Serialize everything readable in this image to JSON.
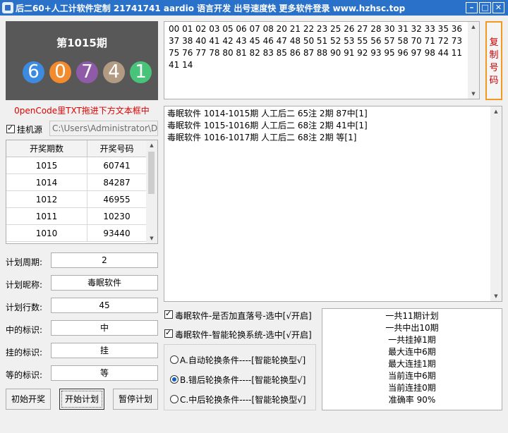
{
  "window": {
    "title": "后二60+人工计软件定制 21741741 aardio 语言开发 出号速度快 更多软件登录 www.hzhsc.top",
    "minimize": "–",
    "maximize": "□",
    "close": "✕"
  },
  "issue": {
    "title": "第1015期",
    "balls": [
      {
        "digit": "6",
        "color": "#3d8be0"
      },
      {
        "digit": "0",
        "color": "#f28a2e"
      },
      {
        "digit": "7",
        "color": "#8f5aa8"
      },
      {
        "digit": "4",
        "color": "#b39a83"
      },
      {
        "digit": "1",
        "color": "#48c37a"
      }
    ]
  },
  "numbers_text": "00 01 02 03 05 06 07 08 20 21 22 23 25 26 27 28 30 31 32 33 35 36 37 38 40 41 42 43 45 46 47 48 50 51 52 53 55 56 57 58 70 71 72 73 75 76 77 78 80 81 82 83 85 86 87 88 90 91 92 93 95 96 97 98 44 11 41 14",
  "copy_button": "复制号码",
  "hint": "0penCode里TXT拖进下方文本框中",
  "hook": {
    "label": "挂机源",
    "path": "C:\\Users\\Administrator\\Desktop"
  },
  "table": {
    "headers": [
      "开奖期数",
      "开奖号码"
    ],
    "rows": [
      [
        "1015",
        "60741"
      ],
      [
        "1014",
        "84287"
      ],
      [
        "1012",
        "46955"
      ],
      [
        "1011",
        "10230"
      ],
      [
        "1010",
        "93440"
      ]
    ]
  },
  "form": {
    "period_label": "计划周期:",
    "period_value": "2",
    "name_label": "计划昵称:",
    "name_value": "毒眠软件",
    "rows_label": "计划行数:",
    "rows_value": "45",
    "hit_label": "中的标识:",
    "hit_value": "中",
    "miss_label": "挂的标识:",
    "miss_value": "挂",
    "wait_label": "等的标识:",
    "wait_value": "等"
  },
  "buttons": {
    "init": "初始开奖",
    "start": "开始计划",
    "pause": "暂停计划"
  },
  "results": [
    "毒眠软件 1014-1015期 人工后二 65注 2期 87中[1]",
    "毒眠软件 1015-1016期 人工后二 68注 2期 41中[1]",
    "毒眠软件 1016-1017期 人工后二 68注 2期 等[1]"
  ],
  "options": {
    "straight": "毒眠软件-是否加直落号-选中[√开启]",
    "smart": "毒眠软件-智能轮换系统-选中[√开启]"
  },
  "radios": [
    {
      "label": "A.自动轮换条件----[智能轮换型√]",
      "selected": false
    },
    {
      "label": "B.错后轮换条件----[智能轮换型√]",
      "selected": true
    },
    {
      "label": "C.中后轮换条件----[智能轮换型√]",
      "selected": false
    }
  ],
  "stats": [
    "一共11期计划",
    "一共中出10期",
    "一共挂掉1期",
    "最大连中6期",
    "最大连挂1期",
    "当前连中6期",
    "当前连挂0期",
    "准确率 90%"
  ]
}
